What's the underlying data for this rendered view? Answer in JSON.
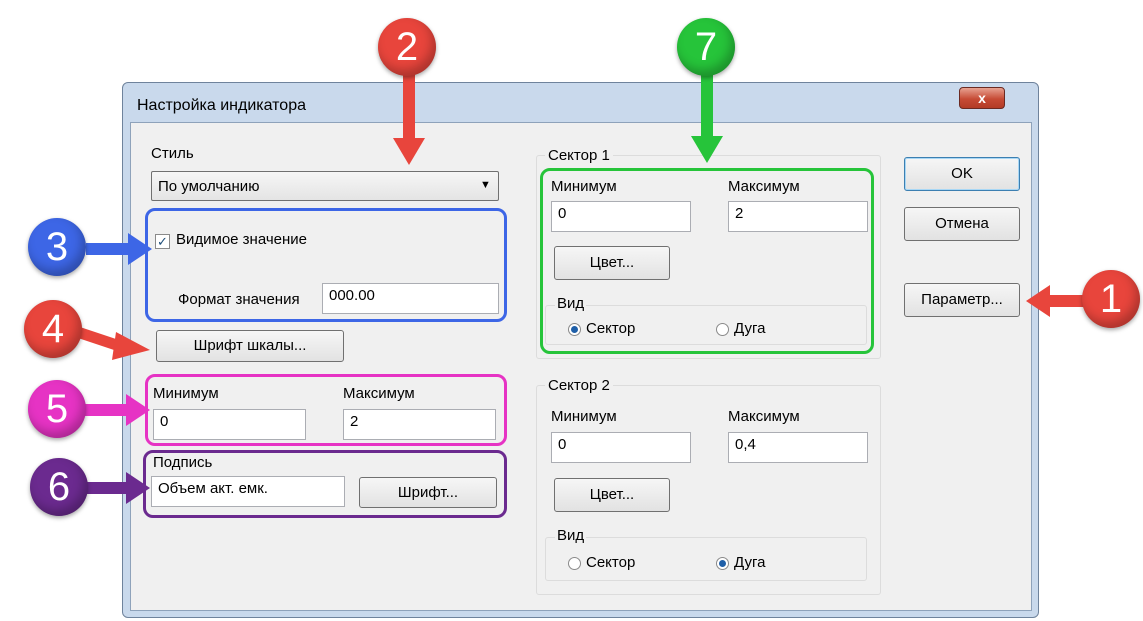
{
  "window": {
    "title": "Настройка индикатора",
    "close_label": "x"
  },
  "left": {
    "style_label": "Стиль",
    "style_value": "По умолчанию",
    "visible_value_label": "Видимое значение",
    "format_label": "Формат значения",
    "format_value": "000.00",
    "scale_font_button": "Шрифт шкалы...",
    "min_label": "Минимум",
    "max_label": "Максимум",
    "min_value": "0",
    "max_value": "2",
    "caption_label": "Подпись",
    "caption_value": "Объем акт. емк.",
    "font_button": "Шрифт..."
  },
  "sector1": {
    "title": "Сектор 1",
    "min_label": "Минимум",
    "max_label": "Максимум",
    "min_value": "0",
    "max_value": "2",
    "color_button": "Цвет...",
    "view_label": "Вид",
    "opt_sector": "Сектор",
    "opt_arc": "Дуга",
    "selected": "sector"
  },
  "sector2": {
    "title": "Сектор 2",
    "min_label": "Минимум",
    "max_label": "Максимум",
    "min_value": "0",
    "max_value": "0,4",
    "color_button": "Цвет...",
    "view_label": "Вид",
    "opt_sector": "Сектор",
    "opt_arc": "Дуга",
    "selected": "arc"
  },
  "buttons": {
    "ok": "OK",
    "cancel": "Отмена",
    "param": "Параметр..."
  },
  "markers": {
    "m1": "1",
    "m2": "2",
    "m3": "3",
    "m4": "4",
    "m5": "5",
    "m6": "6",
    "m7": "7"
  },
  "colors": {
    "marker_red": "#e8453c",
    "marker_blue": "#3d66e6",
    "marker_magenta": "#e633c4",
    "marker_purple": "#6b2a8f",
    "marker_green": "#26c43a"
  }
}
